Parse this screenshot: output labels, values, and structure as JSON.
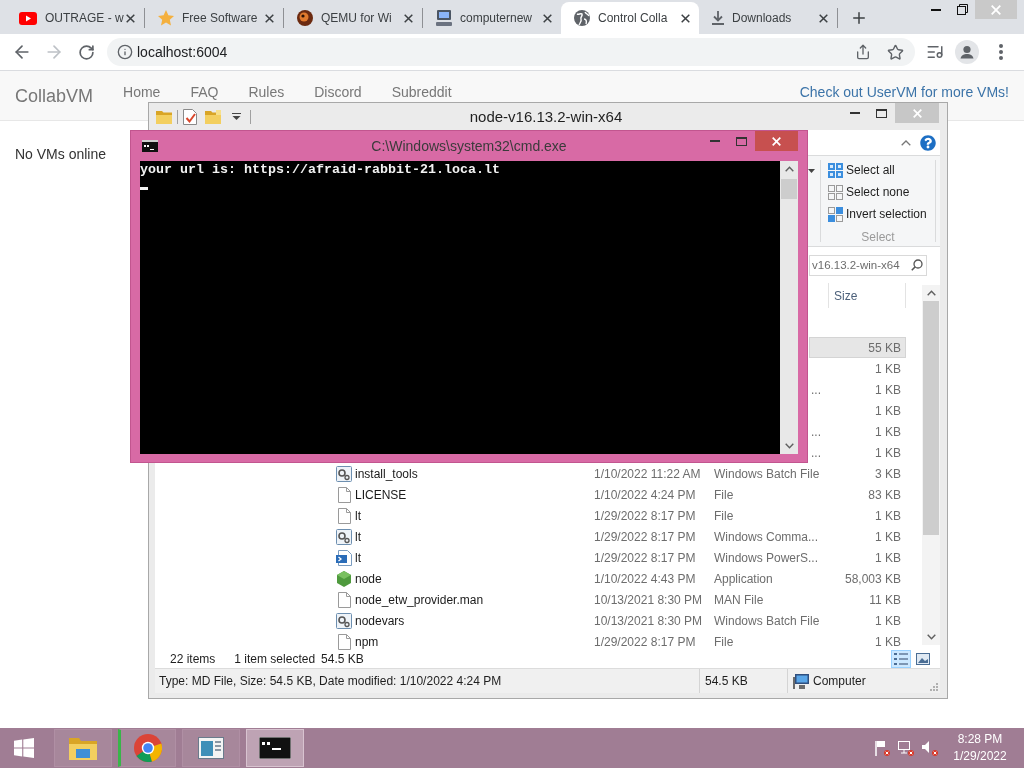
{
  "browser": {
    "tabs": [
      {
        "title": "OUTRAGE - w",
        "selected": false
      },
      {
        "title": "Free Software",
        "selected": false
      },
      {
        "title": "QEMU for Wi",
        "selected": false
      },
      {
        "title": "computernew",
        "selected": false
      },
      {
        "title": "Control Colla",
        "selected": true
      },
      {
        "title": "Downloads",
        "selected": false
      }
    ],
    "address_bar": {
      "url": "localhost:6004"
    }
  },
  "page": {
    "brand": "CollabVM",
    "nav_links": [
      "Home",
      "FAQ",
      "Rules",
      "Discord",
      "Subreddit"
    ],
    "promo_link": "Check out UserVM for more VMs!",
    "status_message": "No VMs online"
  },
  "explorer": {
    "title": "node-v16.13.2-win-x64",
    "ribbon": {
      "commands": [
        "Select all",
        "Select none",
        "Invert selection"
      ],
      "group_label": "Select"
    },
    "search": {
      "placeholder": "v16.13.2-win-x64"
    },
    "columns": [
      "Size"
    ],
    "rows": [
      {
        "kind": "covered",
        "size": "55 KB",
        "selected": true
      },
      {
        "kind": "covered",
        "size": "1 KB",
        "selected": false
      },
      {
        "kind": "covered",
        "type": "...",
        "size": "1 KB",
        "selected": false
      },
      {
        "kind": "covered",
        "size": "1 KB",
        "selected": false
      },
      {
        "kind": "covered",
        "type": "...",
        "size": "1 KB",
        "selected": false
      },
      {
        "kind": "covered",
        "type": "...",
        "size": "1 KB",
        "selected": false
      },
      {
        "kind": "script",
        "name": "install_tools",
        "date": "1/10/2022 11:22 AM",
        "type": "Windows Batch File",
        "size": "3 KB",
        "selected": false
      },
      {
        "kind": "file",
        "name": "LICENSE",
        "date": "1/10/2022 4:24 PM",
        "type": "File",
        "size": "83 KB",
        "selected": false
      },
      {
        "kind": "file",
        "name": "lt",
        "date": "1/29/2022 8:17 PM",
        "type": "File",
        "size": "1 KB",
        "selected": false
      },
      {
        "kind": "script",
        "name": "lt",
        "date": "1/29/2022 8:17 PM",
        "type": "Windows Comma...",
        "size": "1 KB",
        "selected": false
      },
      {
        "kind": "powershell",
        "name": "lt",
        "date": "1/29/2022 8:17 PM",
        "type": "Windows PowerS...",
        "size": "1 KB",
        "selected": false
      },
      {
        "kind": "app",
        "name": "node",
        "date": "1/10/2022 4:43 PM",
        "type": "Application",
        "size": "58,003 KB",
        "selected": false
      },
      {
        "kind": "file",
        "name": "node_etw_provider.man",
        "date": "10/13/2021 8:30 PM",
        "type": "MAN File",
        "size": "11 KB",
        "selected": false
      },
      {
        "kind": "script",
        "name": "nodevars",
        "date": "10/13/2021 8:30 PM",
        "type": "Windows Batch File",
        "size": "1 KB",
        "selected": false
      },
      {
        "kind": "file",
        "name": "npm",
        "date": "1/29/2022 8:17 PM",
        "type": "File",
        "size": "1 KB",
        "selected": false
      }
    ],
    "status": {
      "item_count": "22 items",
      "selection": "1 item selected",
      "selection_size": "54.5 KB"
    },
    "views": [
      {
        "selected": true
      },
      {
        "selected": false
      }
    ],
    "details": {
      "summary": "Type: MD File, Size: 54.5 KB, Date modified: 1/10/2022 4:24 PM",
      "size": "54.5 KB",
      "location": "Computer"
    }
  },
  "console": {
    "title": "C:\\Windows\\system32\\cmd.exe",
    "lines": [
      "your url is: https://afraid-rabbit-21.loca.lt"
    ],
    "cursor_visible": true
  },
  "taskbar": {
    "apps": [
      {
        "selected": false
      },
      {
        "selected": false
      },
      {
        "selected": false
      },
      {
        "selected": true
      }
    ],
    "clock": {
      "time": "8:28 PM",
      "date": "1/29/2022"
    }
  }
}
